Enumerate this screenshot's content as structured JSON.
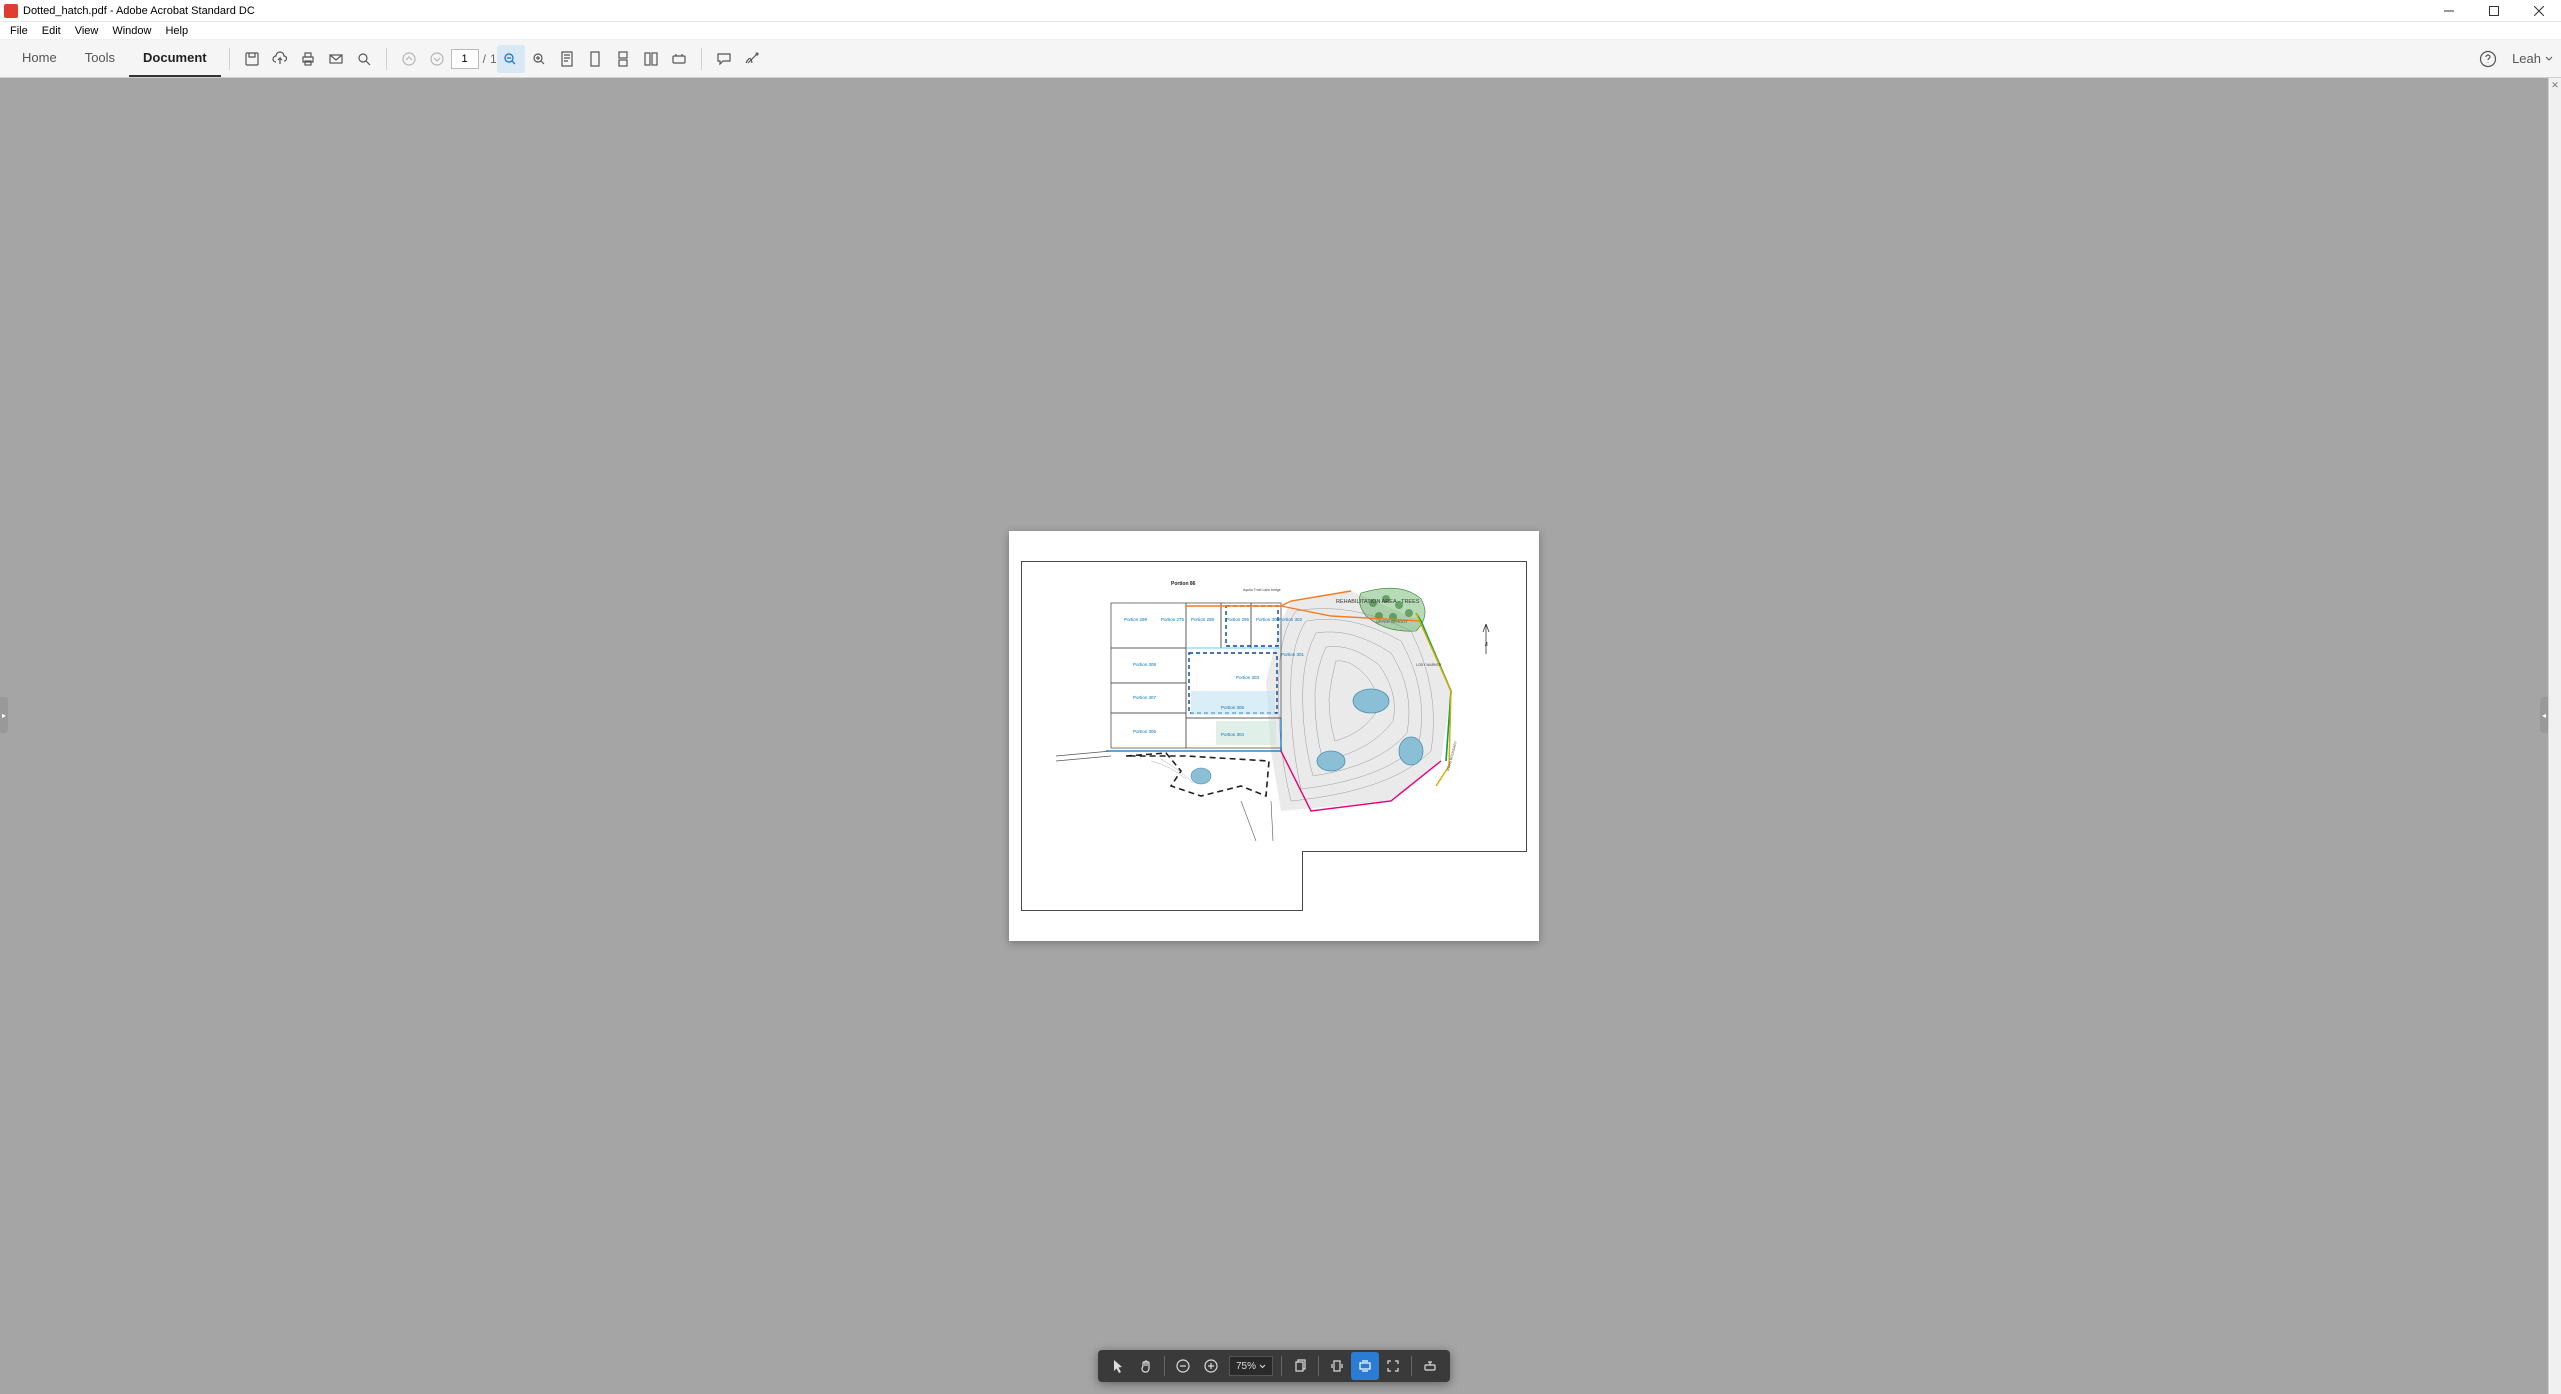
{
  "app": {
    "title": "Dotted_hatch.pdf - Adobe Acrobat Standard DC",
    "filename": "Dotted_hatch.pdf",
    "product": "Adobe Acrobat Standard DC"
  },
  "menubar": {
    "items": [
      "File",
      "Edit",
      "View",
      "Window",
      "Help"
    ]
  },
  "tabs": {
    "home": "Home",
    "tools": "Tools",
    "document": "Document"
  },
  "toolbar": {
    "current_page": "1",
    "page_separator": "/",
    "total_pages": "1",
    "user_name": "Leah",
    "icons": {
      "save": "save-icon",
      "cloud": "cloud-upload-icon",
      "print": "print-icon",
      "email": "email-icon",
      "search": "search-icon",
      "page_up": "page-up-icon",
      "page_down": "page-down-icon",
      "fit_width": "fit-width-icon",
      "zoom": "zoom-icon",
      "page_thumb": "page-thumbnail-icon",
      "single_page": "single-page-icon",
      "scrolling": "scrolling-icon",
      "scrolling2": "scrolling-two-icon",
      "read_mode": "read-mode-icon",
      "comment": "comment-icon",
      "sign": "sign-icon",
      "help": "help-icon"
    }
  },
  "document": {
    "annotations": {
      "rehabilitation": "REHABILITATION AREA - TREES",
      "upper_sproot": "UPPER SPROOT",
      "portion_86": "Portion 86",
      "portion_299": "Portion 299",
      "portion_275": "Portion 275",
      "portion_298": "Portion 298",
      "portion_296": "Portion 296",
      "portion_300": "Portion 300",
      "portion_302": "Portion 302",
      "portion_303": "Portion 303",
      "portion_308": "Portion 308",
      "portion_307": "Portion 307",
      "portion_306": "Portion 306",
      "portion_305": "Portion 305",
      "portion_304": "Portion 304",
      "portion_301": "Portion 301",
      "north_letter": "N",
      "lody_marker": "LODY MARKER",
      "road_boundary": "ROAD BOUNDARY",
      "aquila_bridge": "Aquila Trust Lake bridge"
    }
  },
  "bottom_bar": {
    "zoom_level": "75%",
    "icons": {
      "select": "select-arrow-icon",
      "hand": "hand-tool-icon",
      "zoom_out": "zoom-out-icon",
      "zoom_in": "zoom-in-icon",
      "copy": "copy-pages-icon",
      "fit_page": "fit-page-icon",
      "fit_width2": "fit-width-icon",
      "fullscreen": "fullscreen-icon",
      "read": "read-aloud-icon"
    }
  },
  "colors": {
    "viewer_bg": "#a5a5a5",
    "toolbar_bg": "#f5f5f5",
    "accent": "#2b7cd3",
    "orange": "#f47b20",
    "magenta": "#e6007e",
    "green": "#00a651",
    "blue": "#0072bc",
    "lightblue": "#6fc7e4",
    "yellow": "#d9a800"
  }
}
